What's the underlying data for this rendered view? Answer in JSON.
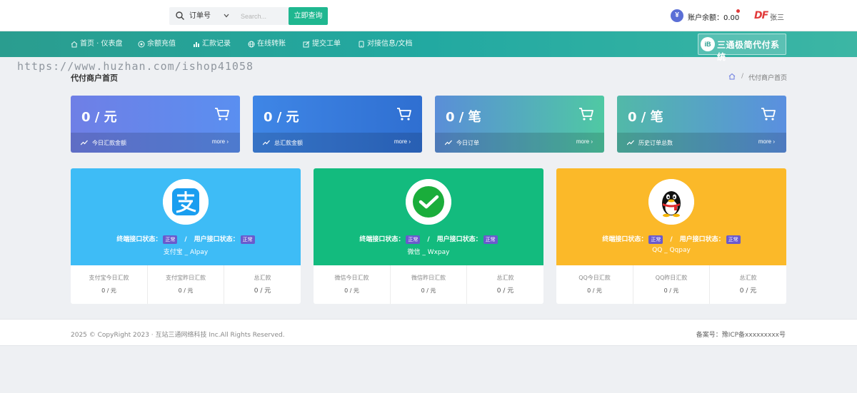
{
  "header": {
    "search_select": "订单号",
    "search_placeholder": "Search...",
    "search_button": "立即查询",
    "balance": "账户余额：0.00",
    "balance_icon": "¥",
    "user_logo": "DF",
    "user_name": "张三"
  },
  "nav": {
    "items": [
      {
        "label": "首页 · 仪表盘",
        "icon": "home-icon"
      },
      {
        "label": "余额充值",
        "icon": "recharge-icon"
      },
      {
        "label": "汇款记录",
        "icon": "chart-icon"
      },
      {
        "label": "在线转账",
        "icon": "globe-icon"
      },
      {
        "label": "提交工单",
        "icon": "edit-icon"
      },
      {
        "label": "对接信息/文档",
        "icon": "document-icon"
      }
    ],
    "brand_badge": "iB",
    "brand_text": "三通极简代付系统"
  },
  "watermark": "https://www.huzhan.com/ishop41058",
  "page": {
    "title": "代付商户首页",
    "breadcrumb_current": "代付商户首页",
    "breadcrumb_sep": "/"
  },
  "stats": [
    {
      "value": "0 / 元",
      "label": "今日汇款金额",
      "more": "more ›",
      "color_from": "#6f7fe6",
      "color_to": "#5a8ff0"
    },
    {
      "value": "0 / 元",
      "label": "总汇款金额",
      "more": "more ›",
      "color_from": "#3f86e6",
      "color_to": "#2f6fd1"
    },
    {
      "value": "0 / 笔",
      "label": "今日订单",
      "more": "more ›",
      "color_from": "#5a8ed8",
      "color_to": "#4fc9a3"
    },
    {
      "value": "0 / 笔",
      "label": "历史订单总数",
      "more": "more ›",
      "color_from": "#52b9a8",
      "color_to": "#5a8fe0"
    }
  ],
  "payments": [
    {
      "bg": "#3ebcf6",
      "status_terminal": "终端接口状态：",
      "status_user": "用户接口状态：",
      "badge": "正常",
      "name": "支付宝 _ Alpay",
      "cols": [
        {
          "label": "支付宝今日汇款",
          "value": "0 / 元"
        },
        {
          "label": "支付宝昨日汇款",
          "value": "0 / 元"
        },
        {
          "label": "总汇款",
          "value": "0 / 元"
        }
      ]
    },
    {
      "bg": "#13bb7e",
      "status_terminal": "终端接口状态：",
      "status_user": "用户接口状态：",
      "badge": "正常",
      "name": "微信 _ Wxpay",
      "cols": [
        {
          "label": "微信今日汇款",
          "value": "0 / 元"
        },
        {
          "label": "微信昨日汇款",
          "value": "0 / 元"
        },
        {
          "label": "总汇款",
          "value": "0 / 元"
        }
      ]
    },
    {
      "bg": "#fbb929",
      "status_terminal": "终端接口状态：",
      "status_user": "用户接口状态：",
      "badge": "正常",
      "name": "QQ _ Qqpay",
      "cols": [
        {
          "label": "QQ今日汇款",
          "value": "0 / 元"
        },
        {
          "label": "QQ昨日汇款",
          "value": "0 / 元"
        },
        {
          "label": "总汇款",
          "value": "0 / 元"
        }
      ]
    }
  ],
  "footer": {
    "copyright": "2025 © CopyRight 2023 · 互站三通网络科技 Inc.All Rights Reserved.",
    "icp": "备案号：豫ICP备xxxxxxxxx号"
  }
}
